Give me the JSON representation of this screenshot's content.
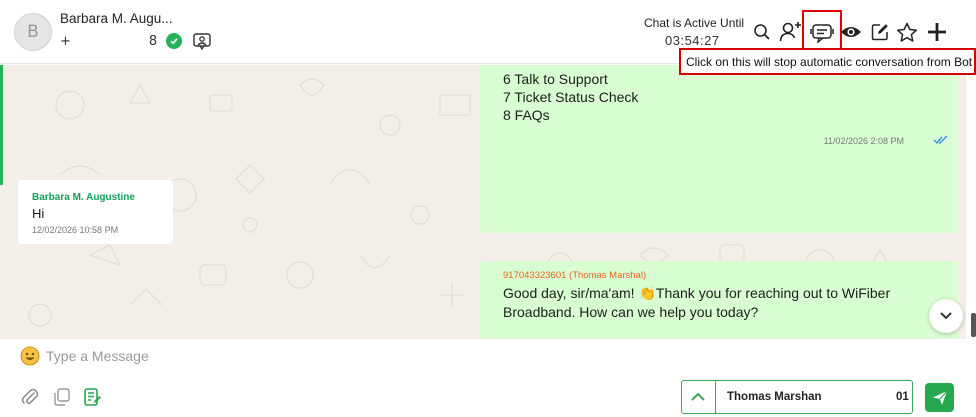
{
  "contact": {
    "avatar_initial": "B",
    "name": "Barbara M. Augu...",
    "phone_prefix": "+",
    "phone_suffix": "8"
  },
  "session": {
    "label": "Chat is Active Until",
    "timer": "03:54:27"
  },
  "toolbar": {
    "icons": [
      "search-icon",
      "assign-user-icon",
      "stop-bot-icon",
      "eye-icon",
      "edit-icon",
      "star-icon",
      "plus-icon"
    ]
  },
  "tooltip": {
    "text": "Click on this will stop automatic conversation from Bot"
  },
  "messages": {
    "menu": {
      "lines": [
        "6 Talk to Support",
        "7 Ticket Status Check",
        "8 FAQs"
      ],
      "time": "11/02/2026 2:08 PM"
    },
    "incoming": {
      "sender": "Barbara M. Augustine",
      "text": "Hi",
      "time": "12/02/2026 10:58 PM"
    },
    "greeting": {
      "sender": "917043323601 (Thomas Marshal)",
      "text": "Good day, sir/ma'am! 👏Thank you for reaching out to WiFiber Broadband. How can we help you today?"
    }
  },
  "composer": {
    "placeholder": "Type a Message",
    "agent_name": "Thomas Marshan",
    "agent_suffix": "01"
  },
  "colors": {
    "accent": "#26a850",
    "outgoing_bubble": "#d9fdd3",
    "highlight": "#e00000"
  }
}
